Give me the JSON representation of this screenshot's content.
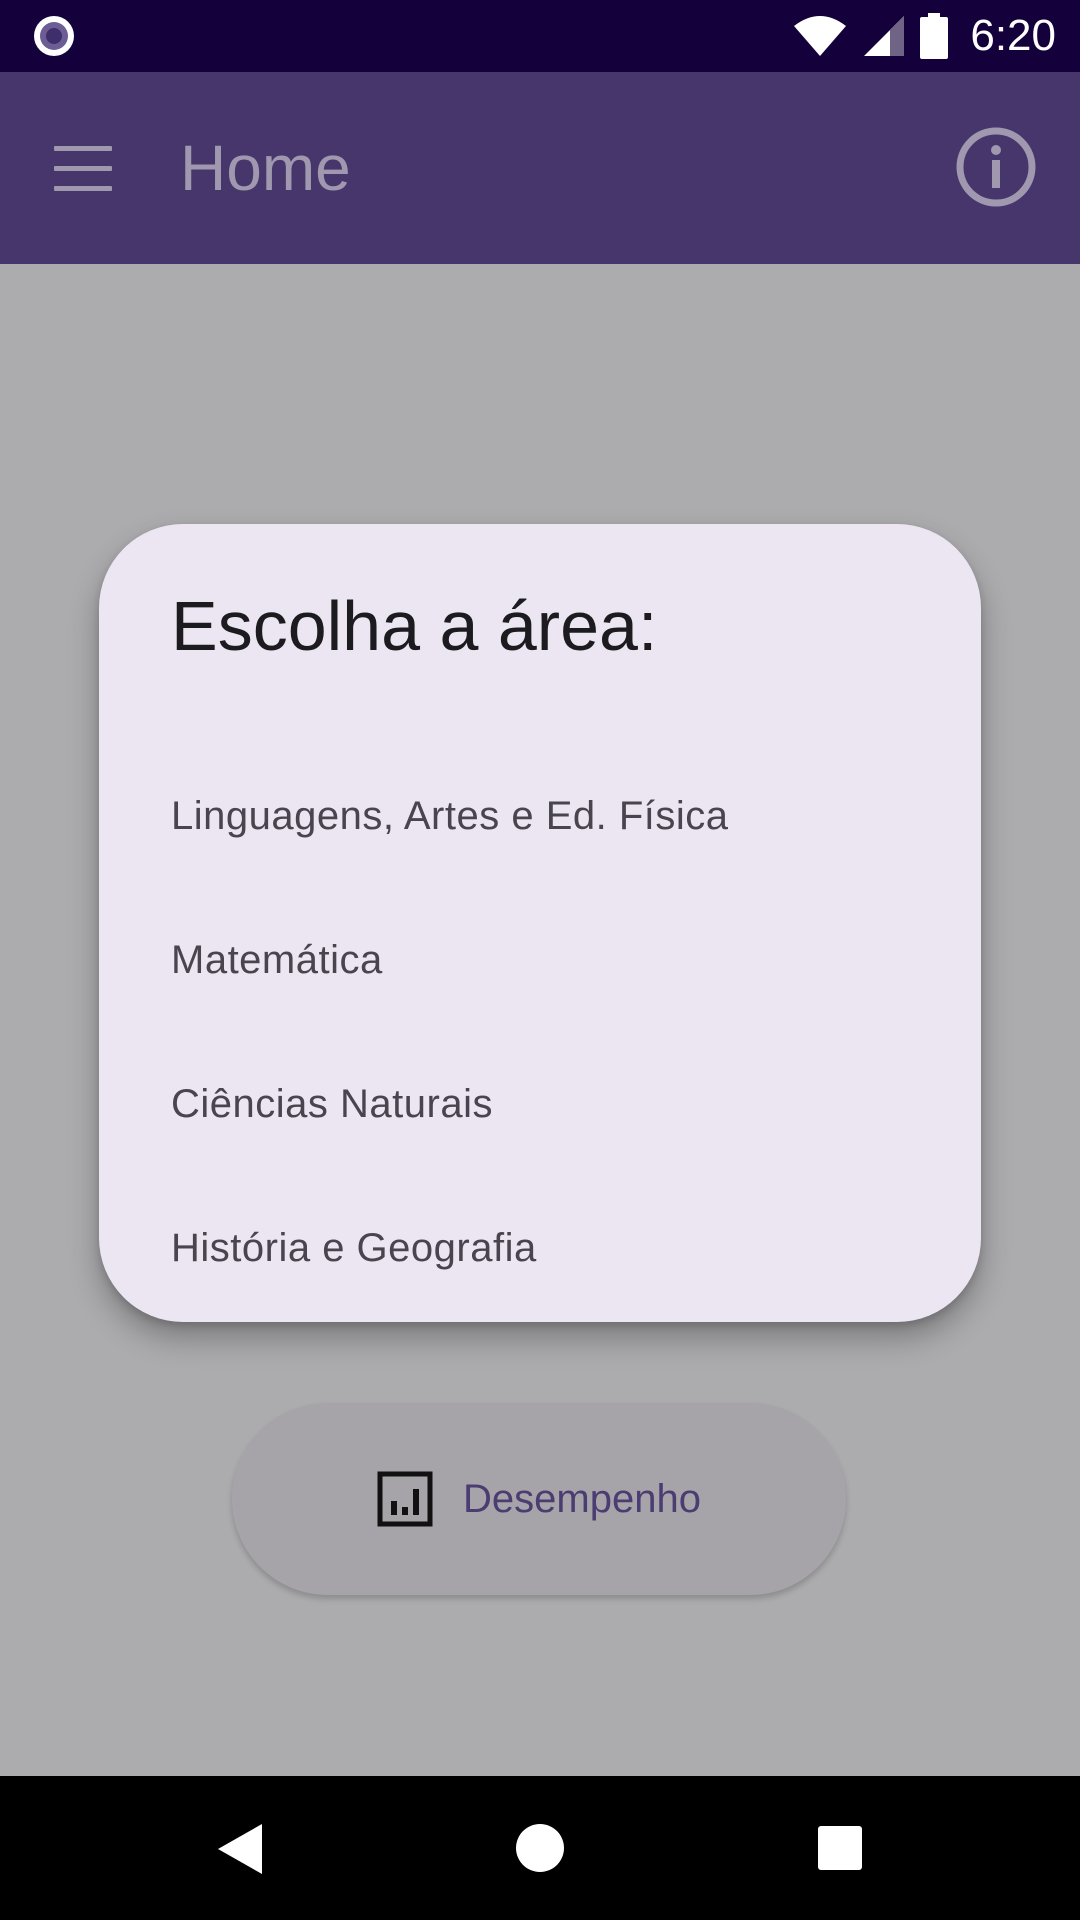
{
  "status_bar": {
    "time": "6:20",
    "icons": [
      "app-notification-icon",
      "wifi-icon",
      "cell-signal-icon",
      "battery-icon"
    ]
  },
  "app_bar": {
    "title": "Home",
    "menu_icon": "hamburger-menu-icon",
    "info_icon": "info-icon",
    "color": "#47366C"
  },
  "dialog": {
    "title": "Escolha a área:",
    "options": [
      "Linguagens, Artes e Ed. Física",
      "Matemática",
      "Ciências Naturais",
      "História e Geografia"
    ],
    "background": "#ECE6F2"
  },
  "main": {
    "performance_button": {
      "label": "Desempenho",
      "icon": "bar-chart-icon"
    }
  },
  "nav_bar": {
    "icons": [
      "back-icon",
      "home-icon",
      "recents-icon"
    ]
  }
}
